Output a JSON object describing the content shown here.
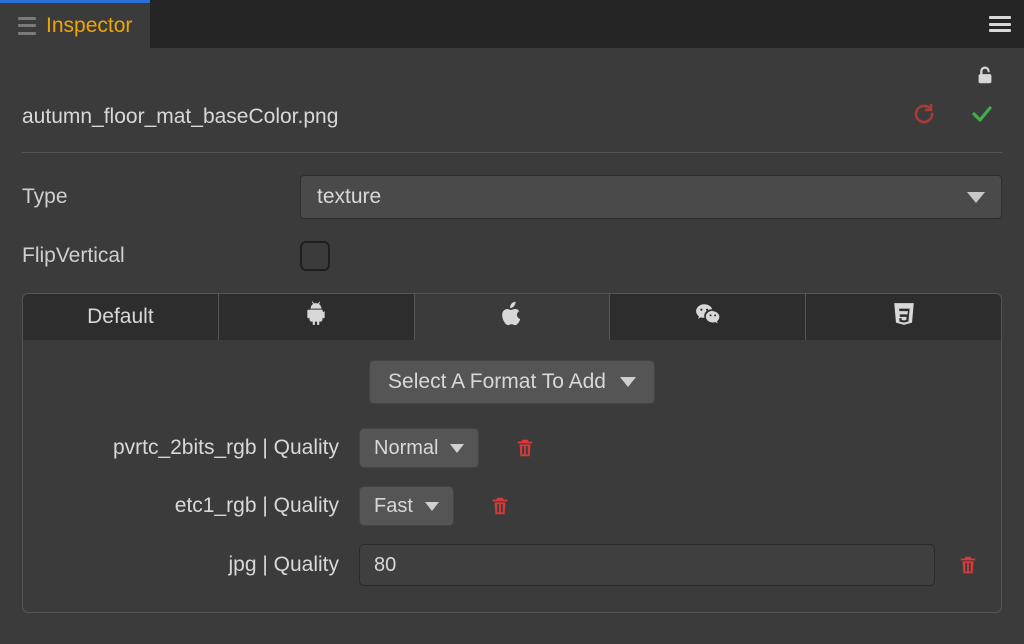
{
  "tab": {
    "title": "Inspector"
  },
  "asset": {
    "filename": "autumn_floor_mat_baseColor.png"
  },
  "fields": {
    "type_label": "Type",
    "type_value": "texture",
    "flip_label": "FlipVertical",
    "flip_checked": false
  },
  "platforms": {
    "default_label": "Default",
    "add_format_label": "Select A Format To Add",
    "formats": [
      {
        "label": "pvrtc_2bits_rgb | Quality",
        "kind": "select",
        "value": "Normal"
      },
      {
        "label": "etc1_rgb | Quality",
        "kind": "select",
        "value": "Fast"
      },
      {
        "label": "jpg | Quality",
        "kind": "number",
        "value": "80"
      }
    ]
  }
}
